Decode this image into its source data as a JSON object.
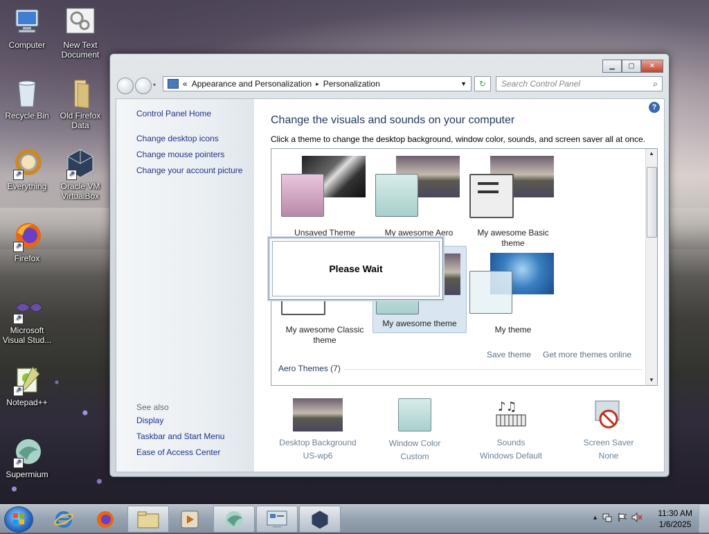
{
  "desktop": {
    "icons": [
      {
        "label_line1": "Computer",
        "label_line2": ""
      },
      {
        "label_line1": "New Text",
        "label_line2": "Document"
      },
      {
        "label_line1": "Recycle Bin",
        "label_line2": ""
      },
      {
        "label_line1": "Old Firefox",
        "label_line2": "Data"
      },
      {
        "label_line1": "Everything",
        "label_line2": ""
      },
      {
        "label_line1": "Oracle VM",
        "label_line2": "VirtualBox"
      },
      {
        "label_line1": "Firefox",
        "label_line2": ""
      },
      {
        "label_line1": "Microsoft",
        "label_line2": "Visual Stud..."
      },
      {
        "label_line1": "Notepad++",
        "label_line2": ""
      },
      {
        "label_line1": "Supermium",
        "label_line2": ""
      }
    ]
  },
  "window": {
    "address": {
      "prefix": "«",
      "crumb1": "Appearance and Personalization",
      "sep": "▸",
      "crumb2": "Personalization"
    },
    "search_placeholder": "Search Control Panel",
    "left_pane": {
      "home": "Control Panel Home",
      "links": [
        "Change desktop icons",
        "Change mouse pointers",
        "Change your account picture"
      ],
      "see_also": "See also",
      "see_also_links": [
        "Display",
        "Taskbar and Start Menu",
        "Ease of Access Center"
      ]
    },
    "main": {
      "title": "Change the visuals and sounds on your computer",
      "description": "Click a theme to change the desktop background, window color, sounds, and screen saver all at once.",
      "themes": [
        {
          "line1": "Unsaved Theme",
          "line2": ""
        },
        {
          "line1": "My awesome Aero",
          "line2": ""
        },
        {
          "line1": "My awesome Basic",
          "line2": "theme"
        },
        {
          "line1": "My awesome Classic",
          "line2": "theme"
        },
        {
          "line1": "My awesome theme",
          "line2": ""
        },
        {
          "line1": "My theme",
          "line2": ""
        }
      ],
      "save_theme": "Save theme",
      "get_more": "Get more themes online",
      "section": "Aero Themes (7)",
      "please_wait": "Please Wait"
    },
    "bottom": [
      {
        "title": "Desktop Background",
        "sub": "US-wp6"
      },
      {
        "title": "Window Color",
        "sub": "Custom"
      },
      {
        "title": "Sounds",
        "sub": "Windows Default"
      },
      {
        "title": "Screen Saver",
        "sub": "None"
      }
    ]
  },
  "taskbar": {
    "time": "11:30 AM",
    "date": "1/6/2025"
  }
}
